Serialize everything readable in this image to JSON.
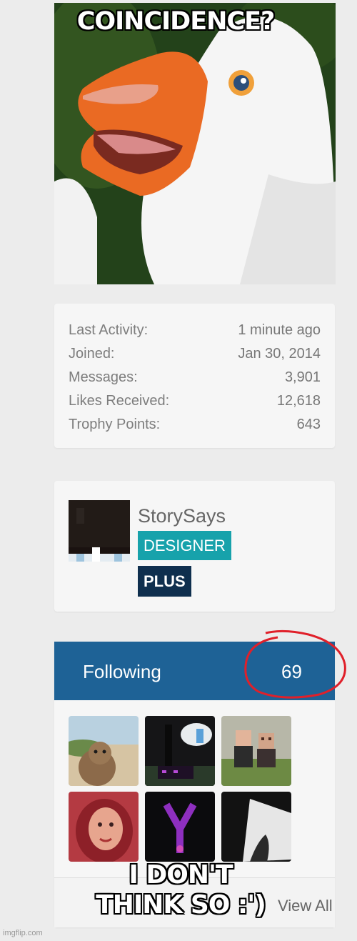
{
  "meme": {
    "top_text": "COINCIDENCE?",
    "bottom_text": "I DON'T THINK SO :')",
    "watermark": "imgflip.com"
  },
  "stats": [
    {
      "label": "Last Activity:",
      "value": "1 minute ago"
    },
    {
      "label": "Joined:",
      "value": "Jan 30, 2014"
    },
    {
      "label": "Messages:",
      "value": "3,901"
    },
    {
      "label": "Likes Received:",
      "value": "12,618"
    },
    {
      "label": "Trophy Points:",
      "value": "643"
    }
  ],
  "profile": {
    "username": "StorySays",
    "badges": [
      "DESIGNER",
      "PLUS"
    ]
  },
  "following": {
    "label": "Following",
    "count": "69",
    "view_all": "View All"
  },
  "colors": {
    "header_blue": "#1e6296",
    "designer_teal": "#17a2ab",
    "plus_navy": "#0f2f4e",
    "annotation_red": "#e0202a"
  }
}
